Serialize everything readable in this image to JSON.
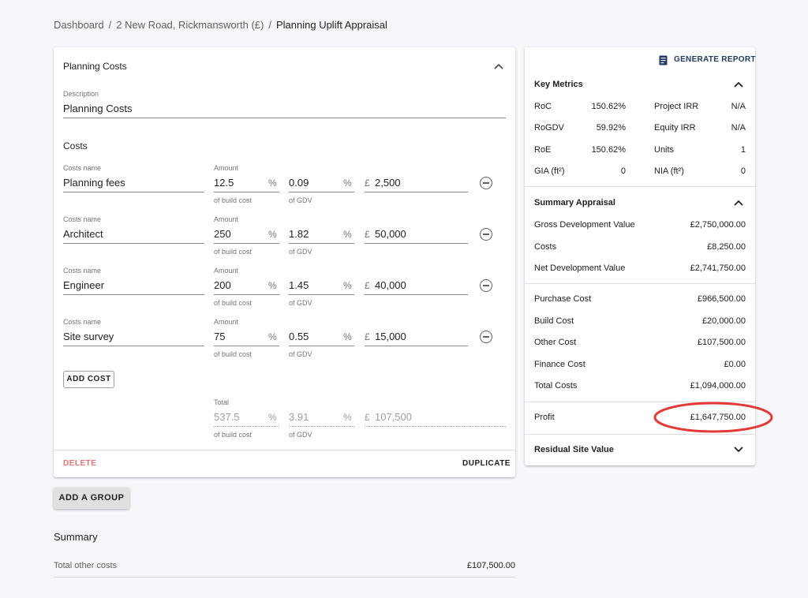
{
  "breadcrumb": {
    "items": [
      "Dashboard",
      "2 New Road, Rickmansworth (£)"
    ],
    "current": "Planning Uplift Appraisal",
    "separator": "/"
  },
  "group": {
    "title": "Planning Costs",
    "description_label": "Description",
    "description_value": "Planning Costs",
    "costs_heading": "Costs",
    "name_label": "Costs name",
    "amount_label": "Amount",
    "percent_unit": "%",
    "currency_unit": "£",
    "build_cost_sub": "of build cost",
    "gdv_sub": "of GDV",
    "rows": [
      {
        "name": "Planning fees",
        "amount": "12.5",
        "gdv": "0.09",
        "value": "2,500"
      },
      {
        "name": "Architect",
        "amount": "250",
        "gdv": "1.82",
        "value": "50,000"
      },
      {
        "name": "Engineer",
        "amount": "200",
        "gdv": "1.45",
        "value": "40,000"
      },
      {
        "name": "Site survey",
        "amount": "75",
        "gdv": "0.55",
        "value": "15,000"
      }
    ],
    "add_cost": "ADD COST",
    "total_label": "Total",
    "total_amount": "537.5",
    "total_gdv": "3.91",
    "total_value": "107,500",
    "delete": "DELETE",
    "duplicate": "DUPLICATE"
  },
  "add_group": "ADD A GROUP",
  "summary": {
    "heading": "Summary",
    "total_other_costs_label": "Total other costs",
    "total_other_costs_value": "£107,500.00"
  },
  "right_panel": {
    "generate_report": "GENERATE REPORT",
    "key_metrics": {
      "title": "Key Metrics",
      "left": [
        {
          "label": "RoC",
          "value": "150.62%"
        },
        {
          "label": "RoGDV",
          "value": "59.92%"
        },
        {
          "label": "RoE",
          "value": "150.62%"
        },
        {
          "label": "GIA (ft²)",
          "value": "0"
        }
      ],
      "right": [
        {
          "label": "Project IRR",
          "value": "N/A"
        },
        {
          "label": "Equity IRR",
          "value": "N/A"
        },
        {
          "label": "Units",
          "value": "1"
        },
        {
          "label": "NIA (ft²)",
          "value": "0"
        }
      ]
    },
    "summary_appraisal": {
      "title": "Summary Appraisal",
      "block1": [
        {
          "label": "Gross Development Value",
          "value": "£2,750,000.00"
        },
        {
          "label": "Costs",
          "value": "£8,250.00"
        },
        {
          "label": "Net Development Value",
          "value": "£2,741,750.00"
        }
      ],
      "block2": [
        {
          "label": "Purchase Cost",
          "value": "£966,500.00"
        },
        {
          "label": "Build Cost",
          "value": "£20,000.00"
        },
        {
          "label": "Other Cost",
          "value": "£107,500.00"
        },
        {
          "label": "Finance Cost",
          "value": "£0.00"
        },
        {
          "label": "Total Costs",
          "value": "£1,094,000.00"
        }
      ],
      "profit_label": "Profit",
      "profit_value": "£1,647,750.00"
    },
    "residual": {
      "title": "Residual Site Value"
    }
  },
  "colors": {
    "delete": "#e57373",
    "highlight": "#e53935",
    "accent": "#1e3a5f"
  }
}
